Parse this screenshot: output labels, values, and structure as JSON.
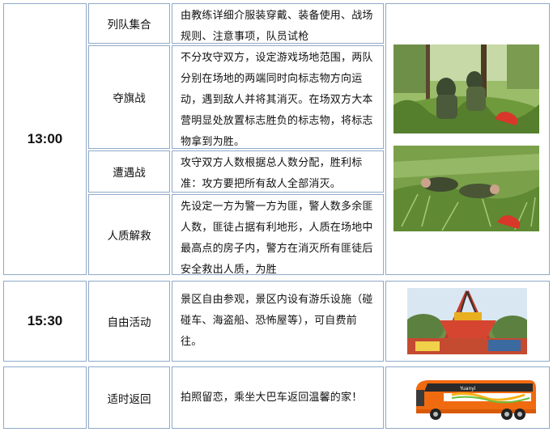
{
  "schedule": [
    {
      "time": "13:00",
      "activities": [
        {
          "name": "列队集合",
          "desc": "由教练详细介服装穿戴、装备使用、战场规则、注意事项，队员试枪"
        },
        {
          "name": "夺旗战",
          "desc": "不分攻守双方，设定游戏场地范围，两队分别在场地的两端同时向标志物方向运动，遇到敌人并将其消灭。在场双方大本营明显处放置标志胜负的标志物，将标志物拿到为胜。"
        },
        {
          "name": "遭遇战",
          "desc": "攻守双方人数根据总人数分配，胜利标准：攻方要把所有敌人全部消灭。"
        },
        {
          "name": "人质解救",
          "desc": "先设定一方为警一方为匪，警人数多余匪人数，匪徒占据有利地形，人质在场地中最高点的房子内，警方在消灭所有匪徒后安全救出人质，为胜"
        }
      ]
    },
    {
      "time": "15:30",
      "activities": [
        {
          "name": "自由活动",
          "desc": "景区自由参观，景区内设有游乐设施（碰碰车、海盗船、恐怖屋等），可自费前往。"
        }
      ]
    },
    {
      "time": "",
      "activities": [
        {
          "name": "适时返回",
          "desc": "拍照留恋，乘坐大巴车返回温馨的家！"
        }
      ]
    }
  ],
  "bus_brand_text": "Yuanyi",
  "colors": {
    "border": "#8fa9c9",
    "grass": "#5f8f3a",
    "bus_orange": "#f06a10"
  }
}
